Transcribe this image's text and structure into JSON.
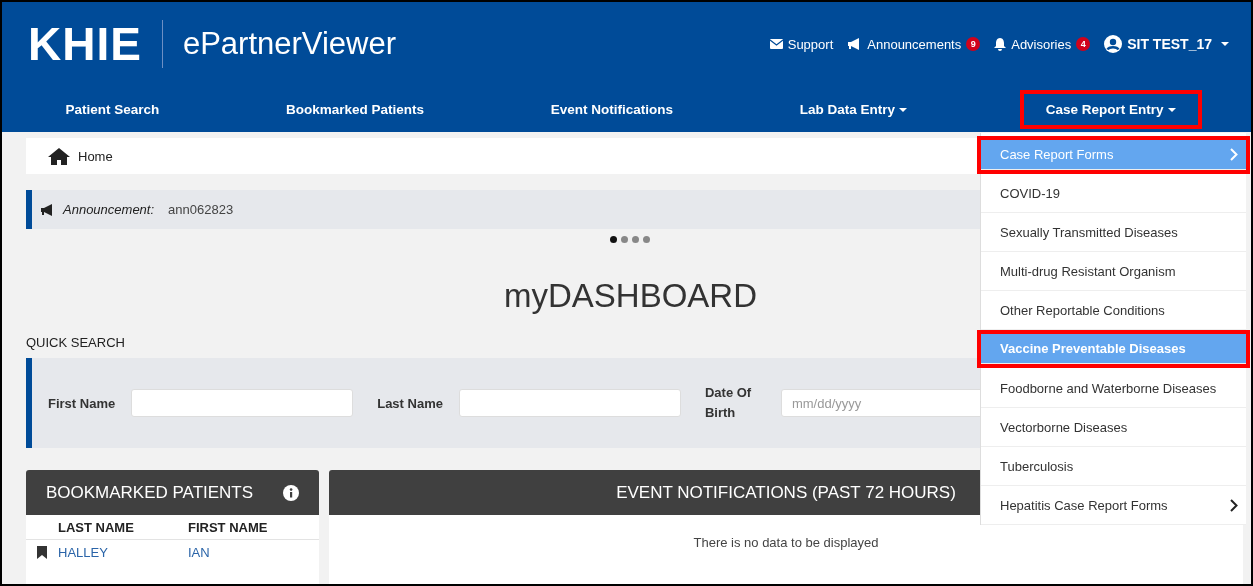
{
  "header": {
    "logo": "KHIE",
    "app_name": "ePartnerViewer",
    "links": [
      {
        "kind": "support",
        "label": "Support"
      },
      {
        "kind": "announcements",
        "label": "Announcements",
        "badge": "9"
      },
      {
        "kind": "advisories",
        "label": "Advisories",
        "badge": "4"
      },
      {
        "kind": "user",
        "label": "SIT TEST_17",
        "dropdown": true
      }
    ]
  },
  "nav": [
    {
      "label": "Patient Search",
      "dropdown": false,
      "highlighted": false
    },
    {
      "label": "Bookmarked Patients",
      "dropdown": false,
      "highlighted": false
    },
    {
      "label": "Event Notifications",
      "dropdown": false,
      "highlighted": false
    },
    {
      "label": "Lab Data Entry",
      "dropdown": true,
      "highlighted": false
    },
    {
      "label": "Case Report Entry",
      "dropdown": true,
      "highlighted": true
    }
  ],
  "breadcrumb": "Home",
  "announcement": {
    "label": "Announcement:",
    "text": "ann062823"
  },
  "carousel_dots": [
    {
      "selected": true
    },
    {
      "selected": false
    },
    {
      "selected": false
    },
    {
      "selected": false
    }
  ],
  "title": "myDASHBOARD",
  "quick_search": {
    "title": "QUICK SEARCH",
    "fields": [
      {
        "label": "First Name"
      },
      {
        "label": "Last Name"
      },
      {
        "label": "Date Of Birth",
        "placeholder": "mm/dd/yyyy"
      }
    ]
  },
  "bookmarked": {
    "title": "BOOKMARKED PATIENTS",
    "columns": [
      "LAST NAME",
      "FIRST NAME"
    ],
    "rows": [
      {
        "last": "HALLEY",
        "first": "IAN"
      }
    ]
  },
  "events": {
    "title": "EVENT NOTIFICATIONS (PAST 72 HOURS)",
    "empty": "There is no data to be displayed"
  },
  "menu": [
    {
      "label": "Case Report Forms",
      "selected": true,
      "highlighted": true,
      "submenu": true
    },
    {
      "label": "COVID-19",
      "selected": false,
      "highlighted": false,
      "submenu": false
    },
    {
      "label": "Sexually Transmitted Diseases",
      "selected": false,
      "highlighted": false,
      "submenu": false
    },
    {
      "label": "Multi-drug Resistant Organism",
      "selected": false,
      "highlighted": false,
      "submenu": false
    },
    {
      "label": "Other Reportable Conditions",
      "selected": false,
      "highlighted": false,
      "submenu": false
    },
    {
      "label": "Vaccine Preventable Diseases",
      "selected": true,
      "highlighted": true,
      "submenu": false
    },
    {
      "label": "Foodborne and Waterborne Diseases",
      "selected": false,
      "highlighted": false,
      "submenu": false
    },
    {
      "label": "Vectorborne Diseases",
      "selected": false,
      "highlighted": false,
      "submenu": false
    },
    {
      "label": "Tuberculosis",
      "selected": false,
      "highlighted": false,
      "submenu": false
    },
    {
      "label": "Hepatitis Case Report Forms",
      "selected": false,
      "highlighted": false,
      "submenu": true
    }
  ]
}
